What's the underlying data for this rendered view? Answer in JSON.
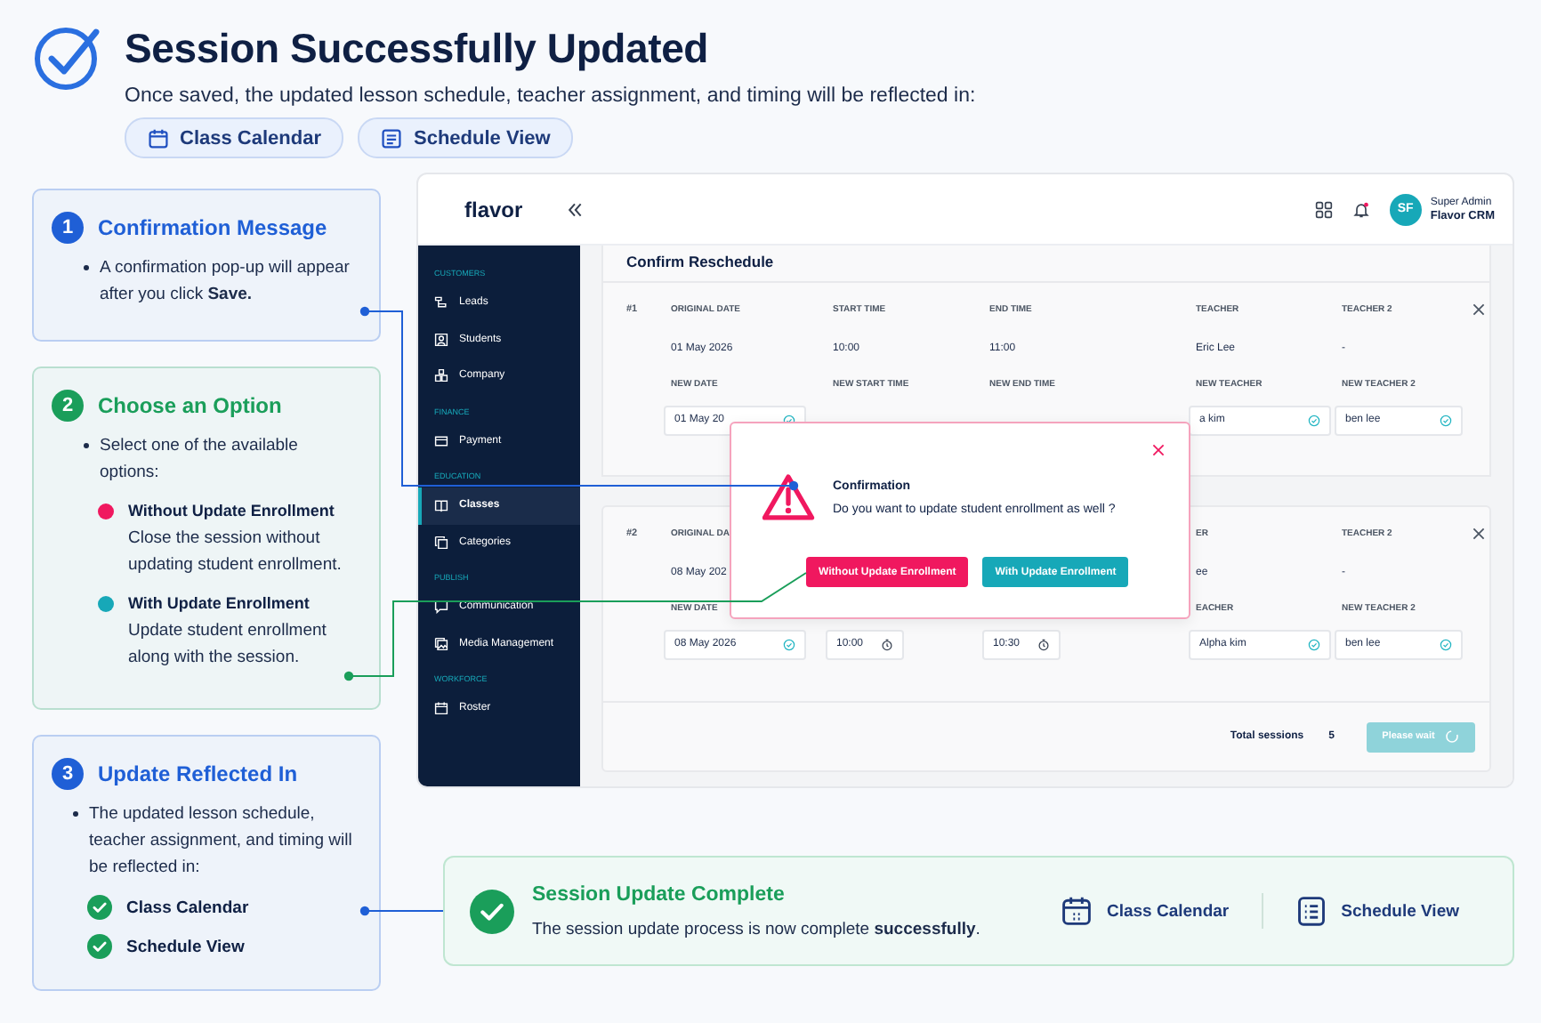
{
  "header": {
    "title": "Session Successfully Updated",
    "subtitle": "Once saved, the updated lesson schedule, teacher assignment, and timing will be reflected in:",
    "chips": [
      {
        "label": "Class Calendar",
        "kind": "calendar"
      },
      {
        "label": "Schedule View",
        "kind": "list"
      }
    ]
  },
  "steps": [
    {
      "number": "1",
      "title": "Confirmation Message",
      "color": "#1f5fd6",
      "bullet": "A confirmation pop-up will appear after you click **Save.**"
    },
    {
      "number": "2",
      "title": "Choose an Option",
      "color": "#1a9e5a",
      "bullet": "Select one of the available options:",
      "options": [
        {
          "title": "Without Update Enrollment",
          "description": "Close the session without updating student enrollment.",
          "color": "#f0185f"
        },
        {
          "title": "With Update Enrollment",
          "description": "Update student enrollment along with the session.",
          "color": "#17a8b8"
        }
      ]
    },
    {
      "number": "3",
      "title": "Update Reflected In",
      "color": "#1f5fd6",
      "bullet": "The updated lesson schedule, teacher assignment, and timing will be reflected in:",
      "checks": [
        "Class Calendar",
        "Schedule View"
      ]
    }
  ],
  "app": {
    "brand": "flavor",
    "user": {
      "initials": "SF",
      "role": "Super Admin",
      "name": "Flavor CRM"
    },
    "sidebar": [
      {
        "label": "CUSTOMERS",
        "items": [
          {
            "label": "Leads",
            "selected": false
          },
          {
            "label": "Students",
            "selected": false
          },
          {
            "label": "Company",
            "selected": false
          }
        ]
      },
      {
        "label": "FINANCE",
        "items": [
          {
            "label": "Payment",
            "selected": false
          }
        ]
      },
      {
        "label": "EDUCATION",
        "items": [
          {
            "label": "Classes",
            "selected": true
          },
          {
            "label": "Categories",
            "selected": false
          }
        ]
      },
      {
        "label": "PUBLISH",
        "items": [
          {
            "label": "Communication",
            "selected": false
          },
          {
            "label": "Media Management",
            "selected": false
          }
        ]
      },
      {
        "label": "WORKFORCE",
        "items": [
          {
            "label": "Roster",
            "selected": false
          }
        ]
      }
    ],
    "panel_title": "Confirm Reschedule",
    "sessions": [
      {
        "number": "#1",
        "columns": [
          {
            "label": "ORIGINAL DATE",
            "value": "01 May 2026",
            "new_label": "NEW DATE",
            "field": {
              "value": "01 May 20",
              "kind": "select"
            }
          },
          {
            "label": "START TIME",
            "value": "10:00",
            "new_label": "NEW START TIME"
          },
          {
            "label": "END TIME",
            "value": "11:00",
            "new_label": "NEW END TIME"
          },
          {
            "label": "TEACHER",
            "value": "Eric Lee",
            "new_label": "NEW TEACHER",
            "field": {
              "value": "a kim",
              "kind": "select"
            }
          },
          {
            "label": "TEACHER 2",
            "value": "-",
            "new_label": "NEW TEACHER 2",
            "field": {
              "value": "ben lee",
              "kind": "select"
            }
          }
        ]
      },
      {
        "number": "#2",
        "columns": [
          {
            "label": "ORIGINAL DA",
            "value": "08 May 202",
            "new_label": "NEW DATE",
            "field": {
              "value": "08 May 2026",
              "kind": "select"
            }
          },
          {
            "field": {
              "value": "10:00",
              "kind": "time"
            }
          },
          {
            "field": {
              "value": "10:30",
              "kind": "time"
            }
          },
          {
            "label": "ER",
            "value": "ee",
            "new_label": "EACHER",
            "field": {
              "value": "Alpha kim",
              "kind": "select"
            }
          },
          {
            "label": "TEACHER 2",
            "value": "-",
            "new_label": "NEW TEACHER 2",
            "field": {
              "value": "ben lee",
              "kind": "select"
            }
          }
        ]
      }
    ],
    "total_label": "Total sessions",
    "total": "5",
    "submit": {
      "label": "Please wait",
      "disabled": true
    },
    "dialog": {
      "title": "Confirmation",
      "message": "Do you want to update student enrollment as well ?",
      "buttons": [
        {
          "label": "Without Update Enrollment",
          "kind": "danger"
        },
        {
          "label": "With Update Enrollment",
          "kind": "primary"
        }
      ]
    }
  },
  "banner": {
    "title": "Session Update Complete",
    "message": "The session update process is now complete **successfully**.",
    "links": [
      {
        "label": "Class Calendar",
        "kind": "calendar"
      },
      {
        "label": "Schedule View",
        "kind": "list"
      }
    ]
  }
}
